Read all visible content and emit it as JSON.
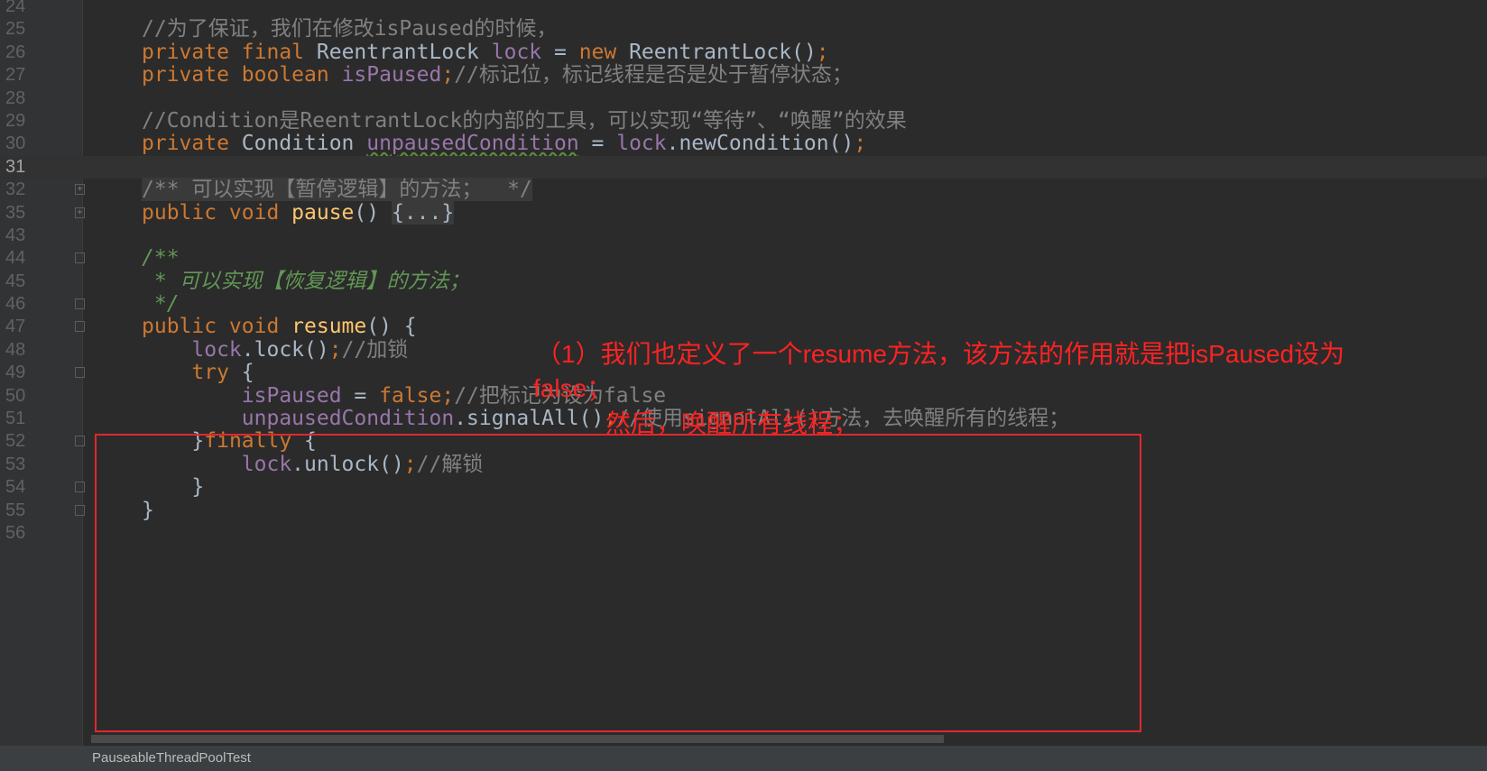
{
  "editor": {
    "current_line": "31",
    "lines": [
      {
        "num": "24",
        "tokens": []
      },
      {
        "num": "25",
        "tokens": [
          {
            "t": "//为了保证，我们在修改isPaused的时候，",
            "c": "cm"
          }
        ]
      },
      {
        "num": "26",
        "tokens": [
          {
            "t": "private final ",
            "c": "kw"
          },
          {
            "t": "ReentrantLock ",
            "c": ""
          },
          {
            "t": "lock",
            "c": "fld"
          },
          {
            "t": " = ",
            "c": ""
          },
          {
            "t": "new ",
            "c": "kw"
          },
          {
            "t": "ReentrantLock()",
            "c": ""
          },
          {
            "t": ";",
            "c": "kw"
          }
        ]
      },
      {
        "num": "27",
        "tokens": [
          {
            "t": "private boolean ",
            "c": "kw"
          },
          {
            "t": "isPaused",
            "c": "fld"
          },
          {
            "t": ";",
            "c": "kw"
          },
          {
            "t": "//标记位，标记线程是否是处于暂停状态；",
            "c": "cm"
          }
        ]
      },
      {
        "num": "28",
        "tokens": []
      },
      {
        "num": "29",
        "tokens": [
          {
            "t": "//Condition是ReentrantLock的内部的工具，可以实现“等待”、“唤醒”的效果",
            "c": "cm"
          }
        ]
      },
      {
        "num": "30",
        "tokens": [
          {
            "t": "private ",
            "c": "kw"
          },
          {
            "t": "Condition ",
            "c": ""
          },
          {
            "t": "unpausedCondition",
            "c": "fld wavy"
          },
          {
            "t": " = ",
            "c": ""
          },
          {
            "t": "lock",
            "c": "fld"
          },
          {
            "t": ".newCondition()",
            "c": ""
          },
          {
            "t": ";",
            "c": "kw"
          }
        ]
      },
      {
        "num": "31",
        "tokens": []
      },
      {
        "num": "32",
        "fold": "+",
        "tokens": [
          {
            "t": "/** 可以实现【暂停逻辑】的方法；  */",
            "c": "cm cmbg"
          }
        ]
      },
      {
        "num": "35",
        "fold": "+",
        "tokens": [
          {
            "t": "public void ",
            "c": "kw"
          },
          {
            "t": "pause",
            "c": "mt"
          },
          {
            "t": "() ",
            "c": ""
          },
          {
            "t": "{...}",
            "c": "foldbox"
          }
        ]
      },
      {
        "num": "43",
        "tokens": []
      },
      {
        "num": "44",
        "fold": "-",
        "tokens": [
          {
            "t": "/**",
            "c": "doc"
          }
        ]
      },
      {
        "num": "45",
        "tokens": [
          {
            "t": " * 可以实现【恢复逻辑】的方法；",
            "c": "doc"
          }
        ]
      },
      {
        "num": "46",
        "fold": "-",
        "tokens": [
          {
            "t": " */",
            "c": "doc"
          }
        ]
      },
      {
        "num": "47",
        "fold": "-",
        "tokens": [
          {
            "t": "public void ",
            "c": "kw"
          },
          {
            "t": "resume",
            "c": "mt"
          },
          {
            "t": "() {",
            "c": ""
          }
        ]
      },
      {
        "num": "48",
        "tokens": [
          {
            "t": "    ",
            "c": ""
          },
          {
            "t": "lock",
            "c": "fld"
          },
          {
            "t": ".lock()",
            "c": ""
          },
          {
            "t": ";",
            "c": "kw"
          },
          {
            "t": "//加锁",
            "c": "cm"
          }
        ]
      },
      {
        "num": "49",
        "fold": "-",
        "tokens": [
          {
            "t": "    ",
            "c": ""
          },
          {
            "t": "try ",
            "c": "kw"
          },
          {
            "t": "{",
            "c": ""
          }
        ]
      },
      {
        "num": "50",
        "tokens": [
          {
            "t": "        ",
            "c": ""
          },
          {
            "t": "isPaused",
            "c": "fld"
          },
          {
            "t": " = ",
            "c": ""
          },
          {
            "t": "false;",
            "c": "kw"
          },
          {
            "t": "//把标记为设为false",
            "c": "cm"
          }
        ]
      },
      {
        "num": "51",
        "tokens": [
          {
            "t": "        ",
            "c": ""
          },
          {
            "t": "unpausedCondition",
            "c": "fld"
          },
          {
            "t": ".signalAll()",
            "c": ""
          },
          {
            "t": ";",
            "c": "kw"
          },
          {
            "t": "//使用signalAll()方法，去唤醒所有的线程；",
            "c": "cm"
          }
        ]
      },
      {
        "num": "52",
        "fold": "-",
        "tokens": [
          {
            "t": "    }",
            "c": ""
          },
          {
            "t": "finally ",
            "c": "kw"
          },
          {
            "t": "{",
            "c": ""
          }
        ]
      },
      {
        "num": "53",
        "tokens": [
          {
            "t": "        ",
            "c": ""
          },
          {
            "t": "lock",
            "c": "fld"
          },
          {
            "t": ".unlock()",
            "c": ""
          },
          {
            "t": ";",
            "c": "kw"
          },
          {
            "t": "//解锁",
            "c": "cm"
          }
        ]
      },
      {
        "num": "54",
        "fold": "-",
        "tokens": [
          {
            "t": "    }",
            "c": ""
          }
        ]
      },
      {
        "num": "55",
        "fold": "-",
        "tokens": [
          {
            "t": "}",
            "c": ""
          }
        ]
      },
      {
        "num": "56",
        "tokens": []
      }
    ]
  },
  "annotation": {
    "line1": "（1）我们也定义了一个resume方法，该方法的作用就是把isPaused设为",
    "line2": "false；",
    "line3": "然后，唤醒所有线程；",
    "color": "#ff2222"
  },
  "status_bar": {
    "file": "PauseableThreadPoolTest"
  }
}
